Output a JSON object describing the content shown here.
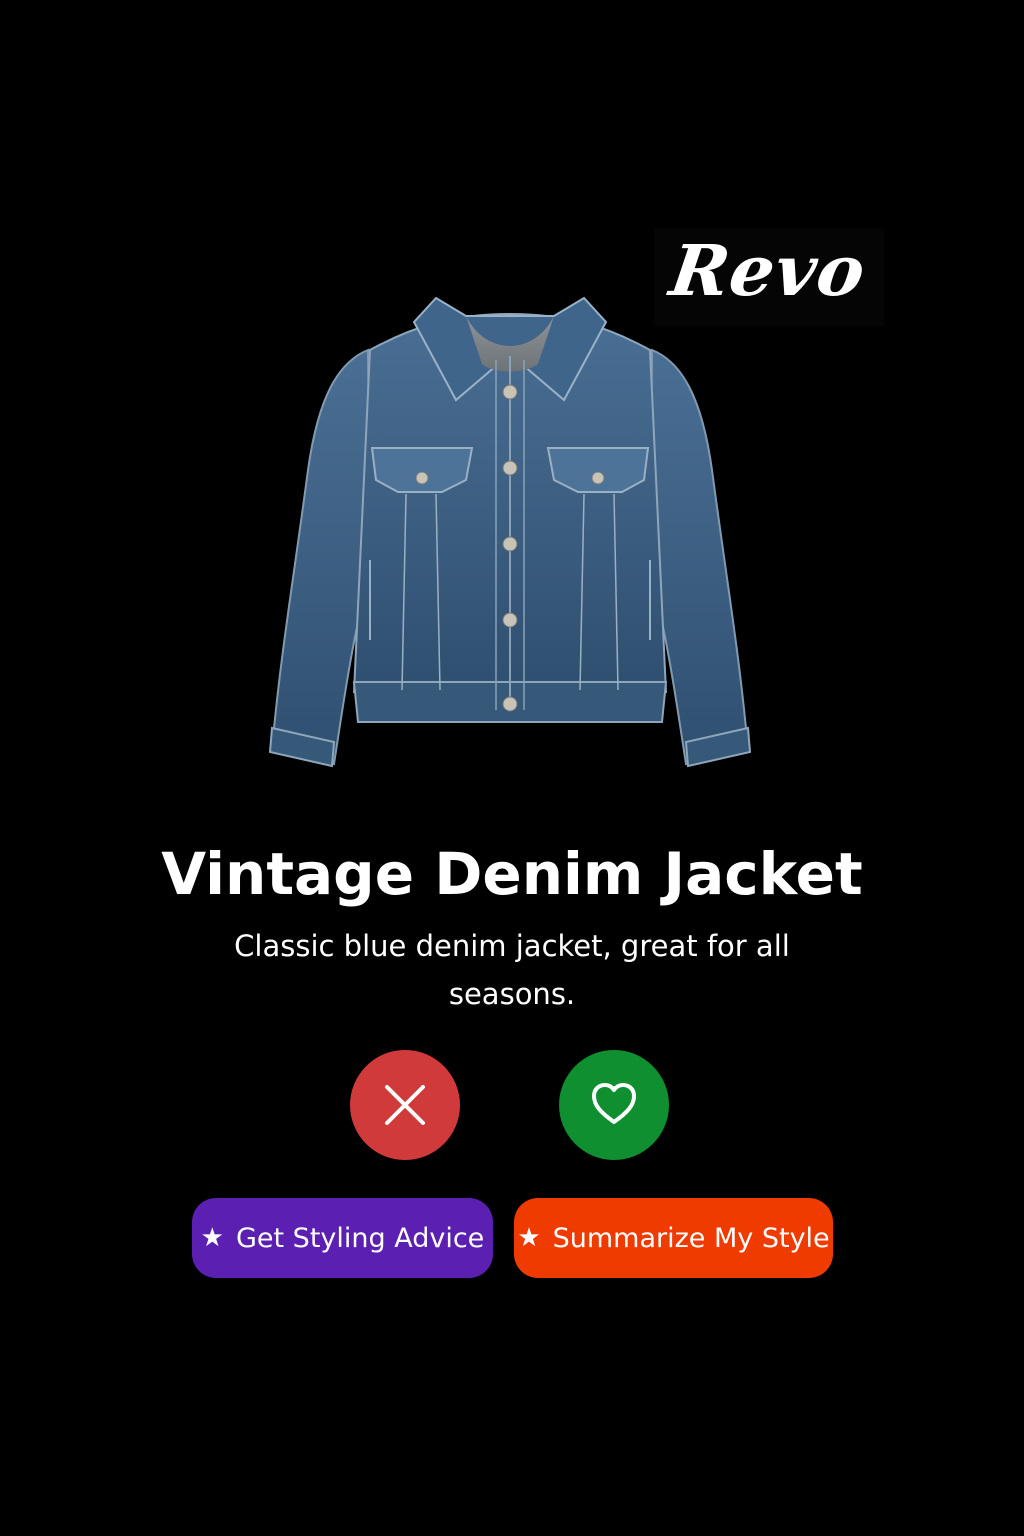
{
  "brand": {
    "logo_text": "Revo"
  },
  "product": {
    "title": "Vintage Denim Jacket",
    "description": "Classic blue denim jacket, great for all seasons.",
    "image_icon": "denim-jacket-image"
  },
  "actions": {
    "dislike_icon": "close-icon",
    "like_icon": "heart-icon",
    "styling_label": "Get Styling Advice",
    "summarize_label": "Summarize My Style",
    "star_icon": "star-icon"
  },
  "colors": {
    "background": "#000000",
    "dislike": "#d13a3a",
    "like": "#0f8f2f",
    "styling_button": "#5b1fb1",
    "summarize_button": "#ef3a00",
    "jacket": "#3d5f82"
  }
}
